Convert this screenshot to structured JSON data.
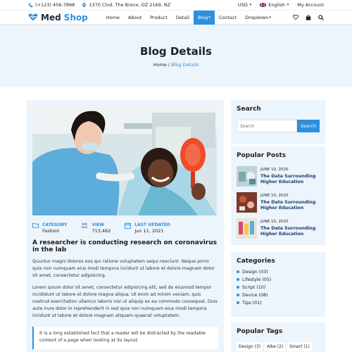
{
  "topbar": {
    "phone": "(+123) 456-7898",
    "address": "1370 Clvd, The Bronx, OZ 2169, NZ",
    "currency": "USD",
    "language": "English",
    "account": "My Account"
  },
  "brand": {
    "name_part1": "Med",
    "name_part2": "Shop"
  },
  "nav": {
    "items": [
      {
        "label": "Home"
      },
      {
        "label": "About"
      },
      {
        "label": "Product"
      },
      {
        "label": "Detail"
      },
      {
        "label": "Blog",
        "active": true,
        "dropdown": true
      },
      {
        "label": "Contact"
      },
      {
        "label": "Dropdown",
        "dropdown": true
      }
    ]
  },
  "hero": {
    "title": "Blog Details",
    "crumb_home": "Home",
    "crumb_sep": "/",
    "crumb_current": "Blog Details"
  },
  "post": {
    "meta": [
      {
        "label": "CATEGORY",
        "value": "Fashion",
        "icon": "folder-icon"
      },
      {
        "label": "VIEW",
        "value": "713,462",
        "icon": "users-icon"
      },
      {
        "label": "LAST UPDATED",
        "value": "Jun 11, 2021",
        "icon": "calendar-icon"
      }
    ],
    "title": "A researcher is conducting research on coronavirus in the lab",
    "paragraph1": "Quuntur magni dolores eos qui ratione voluptatem sequi nesciunt. Neque porro quia non numquam eius modi tempora incidunt ut labore et dolore magnam dolor sit amet, consectetur adipisicing.",
    "paragraph2": "Lorem ipsum dolor sit amet, consectetur adipisicing elit, sed do eiusmod tempor incididunt ut labore et dolore magna aliqua. Ut enim ad minim veniam, quis nostrud exercitation ullamco laboris nisi ut aliquip ex ea commodo consequat. Duis aute irure dolor in reprehenderit in sed quia non numquam eius modi tempora incidunt ut labore et dolore magnam aliquam quaerat voluptatem.",
    "quote": "It is a long established fact that a reader will be distracted by the readable content of a page when looking at its layout."
  },
  "sidebar": {
    "search": {
      "title": "Search",
      "placeholder": "Search",
      "button": "Search"
    },
    "popular": {
      "title": "Popular Posts",
      "items": [
        {
          "date": "JUNE 10, 2020",
          "title": "The Data Surrounding Higher Education"
        },
        {
          "date": "JUNE 10, 2020",
          "title": "The Data Surrounding Higher Education"
        },
        {
          "date": "JUNE 10, 2020",
          "title": "The Data Surrounding Higher Education"
        }
      ]
    },
    "categories": {
      "title": "Categories",
      "items": [
        {
          "label": "Design (03)"
        },
        {
          "label": "Lifestyle (05)"
        },
        {
          "label": "Script (10)"
        },
        {
          "label": "Device (08)"
        },
        {
          "label": "Tips (01)"
        }
      ]
    },
    "tags": {
      "title": "Popular Tags",
      "items": [
        {
          "label": "Design (3)"
        },
        {
          "label": "Aike (2)"
        },
        {
          "label": "Smart (1)"
        }
      ]
    }
  },
  "colors": {
    "accent": "#2f8fdc",
    "panel": "#ecf4fc",
    "dark": "#1e2b3a"
  }
}
